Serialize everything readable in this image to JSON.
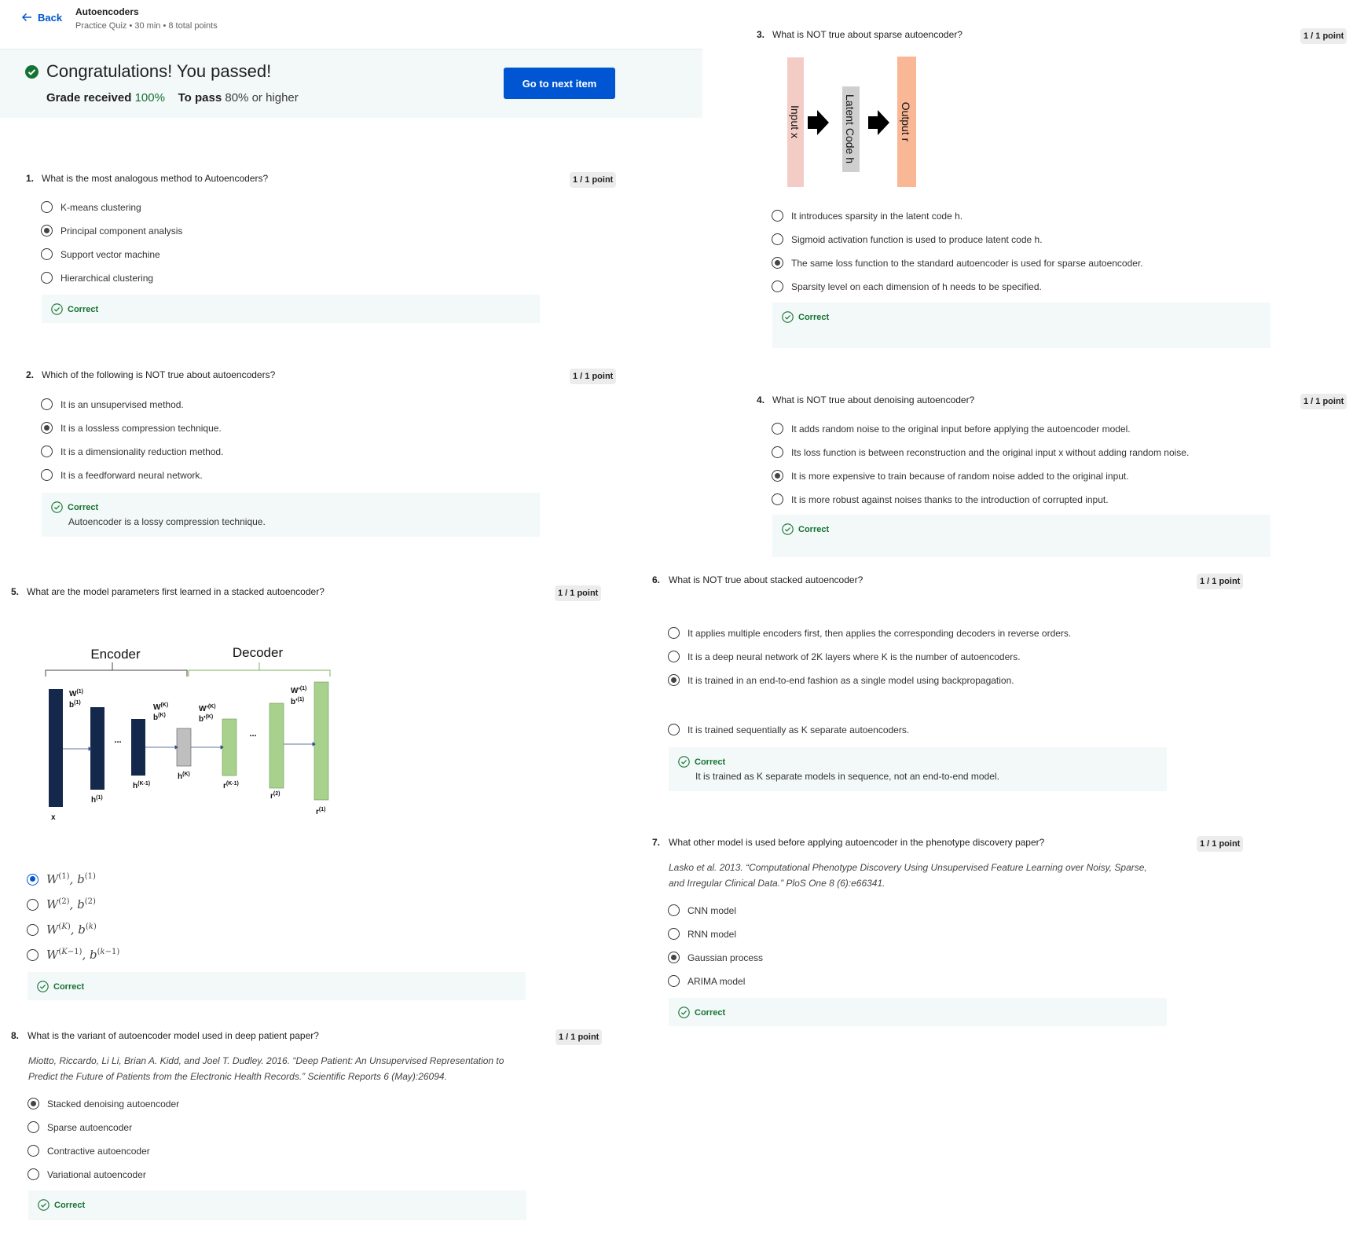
{
  "header": {
    "back_label": "Back",
    "title": "Autoencoders",
    "subtitle": "Practice Quiz • 30 min • 8 total points"
  },
  "banner": {
    "title": "Congratulations! You passed!",
    "grade_label": "Grade received",
    "grade_value": "100%",
    "pass_label": "To pass",
    "pass_value": "80% or higher",
    "next_button": "Go to next item"
  },
  "correct_label": "Correct",
  "questions": [
    {
      "num": "1.",
      "text": "What is the most analogous method to Autoencoders?",
      "points": "1 / 1 point",
      "options": [
        "K-means clustering",
        "Principal component analysis",
        "Support vector machine",
        "Hierarchical clustering"
      ],
      "selected": 1,
      "explanation": ""
    },
    {
      "num": "2.",
      "text": "Which of the following is NOT true about autoencoders?",
      "points": "1 / 1 point",
      "options": [
        "It is an unsupervised method.",
        "It is a lossless compression technique.",
        "It is a dimensionality reduction method.",
        "It is a feedforward neural network."
      ],
      "selected": 1,
      "explanation": "Autoencoder is a lossy compression technique."
    },
    {
      "num": "3.",
      "text": "What is NOT true about sparse autoencoder?",
      "points": "1 / 1 point",
      "diagram": {
        "input": "Input x",
        "latent": "Latent Code h",
        "output": "Output r"
      },
      "options": [
        "It introduces sparsity in the latent code h.",
        "Sigmoid activation function is used to produce latent code h.",
        "The same loss function to the standard autoencoder is used for sparse autoencoder.",
        "Sparsity level on each dimension of h needs to be specified."
      ],
      "selected": 2,
      "explanation": ""
    },
    {
      "num": "4.",
      "text": "What is NOT true about denoising autoencoder?",
      "points": "1 / 1 point",
      "options": [
        "It adds random noise to the original input before applying the autoencoder model.",
        "Its loss function is between reconstruction and the original input x without adding random noise.",
        "It is more expensive to train because of random noise added to the original input.",
        "It is more robust against noises thanks to the introduction of corrupted input."
      ],
      "selected": 2,
      "explanation": ""
    },
    {
      "num": "5.",
      "text": "What are the model parameters first learned in a stacked autoencoder?",
      "points": "1 / 1 point",
      "diagram": {
        "encoder": "Encoder",
        "decoder": "Decoder"
      },
      "options": [
        "W(1), b(1)",
        "W(2), b(2)",
        "W(K), b(k)",
        "W(K−1), b(k−1)"
      ],
      "selected": 0,
      "explanation": ""
    },
    {
      "num": "6.",
      "text": "What is NOT true about stacked autoencoder?",
      "points": "1 / 1 point",
      "options": [
        "It applies multiple encoders first, then applies the corresponding decoders in reverse orders.",
        "It is a deep neural network of 2K layers where K is the number of autoencoders.",
        "It is trained in an end-to-end fashion as a single model using backpropagation.",
        "It is trained sequentially as K separate autoencoders."
      ],
      "selected": 2,
      "explanation": "It is trained as K separate models in sequence, not an end-to-end model."
    },
    {
      "num": "7.",
      "text": "What other model is used before applying autoencoder in the phenotype discovery paper?",
      "points": "1 / 1 point",
      "citation": [
        "Lasko et al. 2013. “Computational Phenotype Discovery Using Unsupervised Feature Learning over Noisy, Sparse,",
        "and Irregular Clinical Data.” PloS One 8 (6):e66341."
      ],
      "options": [
        "CNN model",
        "RNN model",
        "Gaussian process",
        "ARIMA model"
      ],
      "selected": 2,
      "explanation": ""
    },
    {
      "num": "8.",
      "text": "What is the variant of autoencoder model used in deep patient paper?",
      "points": "1 / 1 point",
      "citation": [
        "Miotto, Riccardo, Li Li, Brian A. Kidd, and Joel T. Dudley. 2016. “Deep Patient: An Unsupervised Representation to",
        "Predict the Future of Patients from the Electronic Health Records.” Scientific Reports 6 (May):26094."
      ],
      "options": [
        "Stacked denoising autoencoder",
        "Sparse autoencoder",
        "Contractive autoencoder",
        "Variational autoencoder"
      ],
      "selected": 0,
      "explanation": ""
    }
  ],
  "colors": {
    "accent": "#0056d2",
    "success": "#137333",
    "banner_bg": "#f3f8f8",
    "encoder_bar": "#14284b",
    "decoder_bar": "#a9d18e",
    "latent_bar": "#bfbfbf"
  }
}
